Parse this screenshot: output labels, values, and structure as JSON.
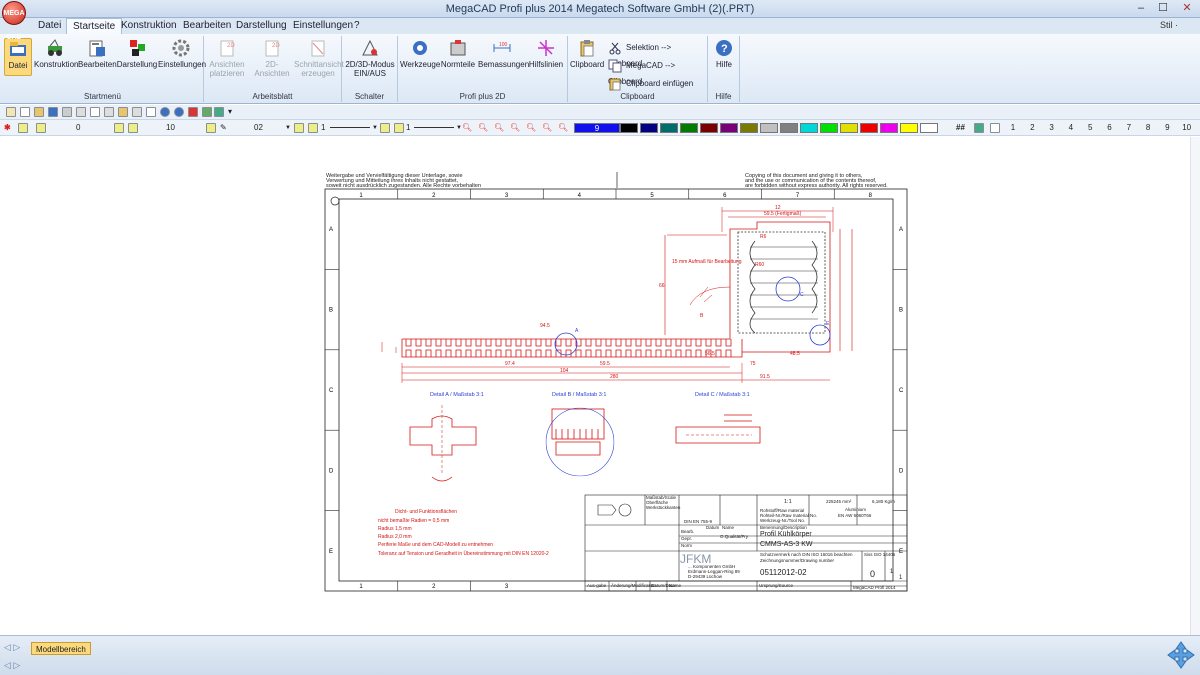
{
  "window": {
    "title": "MegaCAD Profi plus 2014  Megatech Software GmbH (2)(.PRT)",
    "logo_text": "MEGA CAD",
    "min": "–",
    "max": "☐",
    "close": "✕"
  },
  "menu": {
    "tabs": [
      "Datei",
      "Startseite",
      "Konstruktion",
      "Bearbeiten",
      "Darstellung",
      "Einstellungen",
      "?"
    ],
    "active": 1,
    "stil": "Stil ·"
  },
  "ribbon": {
    "startmenu": {
      "label": "Startmenü",
      "buttons": [
        "Datei",
        "Konstruktion",
        "Bearbeiten",
        "Darstellung",
        "Einstellungen"
      ]
    },
    "arbeitsblatt": {
      "label": "Arbeitsblatt",
      "buttons": [
        [
          "Ansichten",
          "platzieren"
        ],
        [
          "2D-Ansichten",
          ""
        ],
        [
          "Schnittansicht",
          "erzeugen"
        ]
      ]
    },
    "schalter": {
      "label": "Schalter",
      "button": [
        "2D/3D-Modus",
        "EIN/AUS"
      ]
    },
    "profi2d": {
      "label": "Profi plus 2D",
      "buttons": [
        "Werkzeuge",
        "Normteile",
        "Bemassungen",
        "Hilfslinien"
      ]
    },
    "clipboard": {
      "label": "Clipboard",
      "big": "Clipboard",
      "items": [
        "Selektion --> Clipboard",
        "MegaCAD --> Clipboard",
        "Clipboard einfügen"
      ]
    },
    "hilfe": {
      "label": "Hilfe",
      "button": "Hilfe"
    }
  },
  "toolbar2": {
    "fields": [
      "0",
      "10",
      "02",
      "1",
      "1"
    ],
    "palette": [
      {
        "c": "#1010ee",
        "t": "9"
      },
      {
        "c": "#000000",
        "t": ""
      },
      {
        "c": "#000080",
        "t": ""
      },
      {
        "c": "#006d6d",
        "t": ""
      },
      {
        "c": "#007a00",
        "t": ""
      },
      {
        "c": "#7a0000",
        "t": ""
      },
      {
        "c": "#7a007a",
        "t": ""
      },
      {
        "c": "#7a7a00",
        "t": ""
      },
      {
        "c": "#c0c0c0",
        "t": ""
      },
      {
        "c": "#808080",
        "t": ""
      },
      {
        "c": "#00d8d8",
        "t": ""
      },
      {
        "c": "#00e000",
        "t": ""
      },
      {
        "c": "#e0e000",
        "t": ""
      },
      {
        "c": "#ee0000",
        "t": ""
      },
      {
        "c": "#ee00ee",
        "t": ""
      },
      {
        "c": "#ffff00",
        "t": ""
      },
      {
        "c": "#ffffff",
        "t": ""
      }
    ],
    "digits": [
      "1",
      "2",
      "3",
      "4",
      "5",
      "6",
      "7",
      "8",
      "9",
      "10"
    ]
  },
  "drawing": {
    "notice_left": [
      "Weitergabe und Vervielfältigung dieser Unterlage, sowie",
      "Verwertung und Mitteilung ihres Inhalts nicht gestattet,",
      "soweit nicht ausdrücklich zugestanden. Alle Rechte vorbehalten"
    ],
    "notice_right": [
      "Copying of this document and giving it to others,",
      "and the use or communication of the contents thereof,",
      "are forbidden without express authority. All rights reserved."
    ],
    "cols": [
      "1",
      "2",
      "3",
      "4",
      "5",
      "6",
      "7",
      "8"
    ],
    "cols_bottom": [
      "1",
      "2",
      "3"
    ],
    "rows": [
      "A",
      "B",
      "C",
      "D",
      "E"
    ],
    "details": [
      "Detail A / Maßstab 3:1",
      "Detail B / Maßstab 3:1",
      "Detail C / Maßstab 3:1"
    ],
    "notes": [
      "Dicht- und Funktionsflächen",
      "nicht bemaßte Radien = 0,5 mm",
      "Radius 1,5 mm",
      "Radius 2,0 mm",
      "Periferie Maße und dem CAD-Modell zu entnehmen",
      "Toleranz auf Tension und Geradheit in Übereinstimmung mit DIN EN 12020-2"
    ],
    "dims": [
      "94.5",
      "97.4",
      "59.5",
      "104",
      "280",
      "91.5",
      "15 mm Aufmaß für Bearbeitung",
      "12",
      "59.5 (Fertigmaß)",
      "R6",
      "R60",
      "C",
      "E",
      "A",
      "B",
      "56.5",
      "48.5",
      "66",
      "75"
    ],
    "tb": {
      "company": "JFKM",
      "company_addr": [
        "... Komponenten GmbH",
        "Erdmann-Leggan-Ring 89",
        "D-29439 Lüchow"
      ],
      "title_label": "Benennung/Description",
      "title": "Profil Kühlkörper",
      "title2": "CMMS-AS-3 KW",
      "drawing_no_label": "Zeichnungsnummer/Drawing number",
      "drawing_no": "05112012-02",
      "rev": "0",
      "sheet": "1",
      "sheets": "1",
      "scale": "1:1",
      "surface": "225245 mm²",
      "weight": "6,180 Kg/m",
      "material": [
        "Aluminium",
        "EN AW 6060T66"
      ],
      "iso": "Siss ISO 14405",
      "schutz": "Schutzvermerk nach DIN ISO 16016 beachten",
      "din": "DIN EN 755-9",
      "stamp": "MegaCAD Profi 2014",
      "qual": "O.Qualität/Fry",
      "roh": [
        "Rohstoff/Raw material",
        "Rohteil-Nr./Raw material No.",
        "Werkzeug-Nr./Tool No."
      ],
      "gepr": [
        "Bearb.",
        "Gepr.",
        "Norm"
      ],
      "dates": [
        "Datum",
        "Name"
      ],
      "rows_left": [
        "Maßstab/Scale",
        "Oberfläche",
        "Werkstückkanten"
      ],
      "bottom": [
        "Aus-gabe",
        "Änderung/Modification",
        "Datum/Date",
        "Name",
        "Ursprung/Source",
        "Ersatz für/Replaces"
      ]
    }
  },
  "status": {
    "tab": "Modellbereich",
    "arrows": "◁ ▷",
    "arrows2": "◁ ▷"
  }
}
